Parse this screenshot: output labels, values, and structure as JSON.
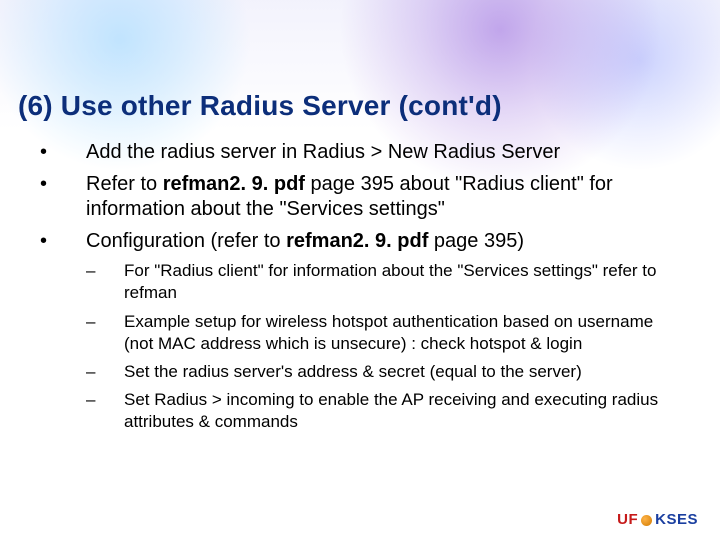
{
  "title": "(6) Use other Radius Server (cont'd)",
  "bullets": {
    "b1": "Add the radius server in Radius > New Radius Server",
    "b2_pre": "Refer to ",
    "b2_bold": "refman2. 9. pdf",
    "b2_post": " page 395 about \"Radius client\" for information about the \"Services settings\"",
    "b3_pre": "Configuration (refer to ",
    "b3_bold": "refman2. 9. pdf",
    "b3_post": " page 395)"
  },
  "sub": {
    "s1": "For \"Radius client\" for information about the \"Services settings\" refer to refman",
    "s2": "Example setup for wireless hotspot authentication based on username (not MAC address which is unsecure) : check hotspot & login",
    "s3": "Set the radius server's address & secret (equal to the server)",
    "s4": "Set Radius > incoming to enable the AP receiving and executing radius attributes & commands"
  },
  "marks": {
    "bullet": "•",
    "dash": "–"
  },
  "logo": {
    "uf": "UF",
    "kses": "KSES"
  }
}
